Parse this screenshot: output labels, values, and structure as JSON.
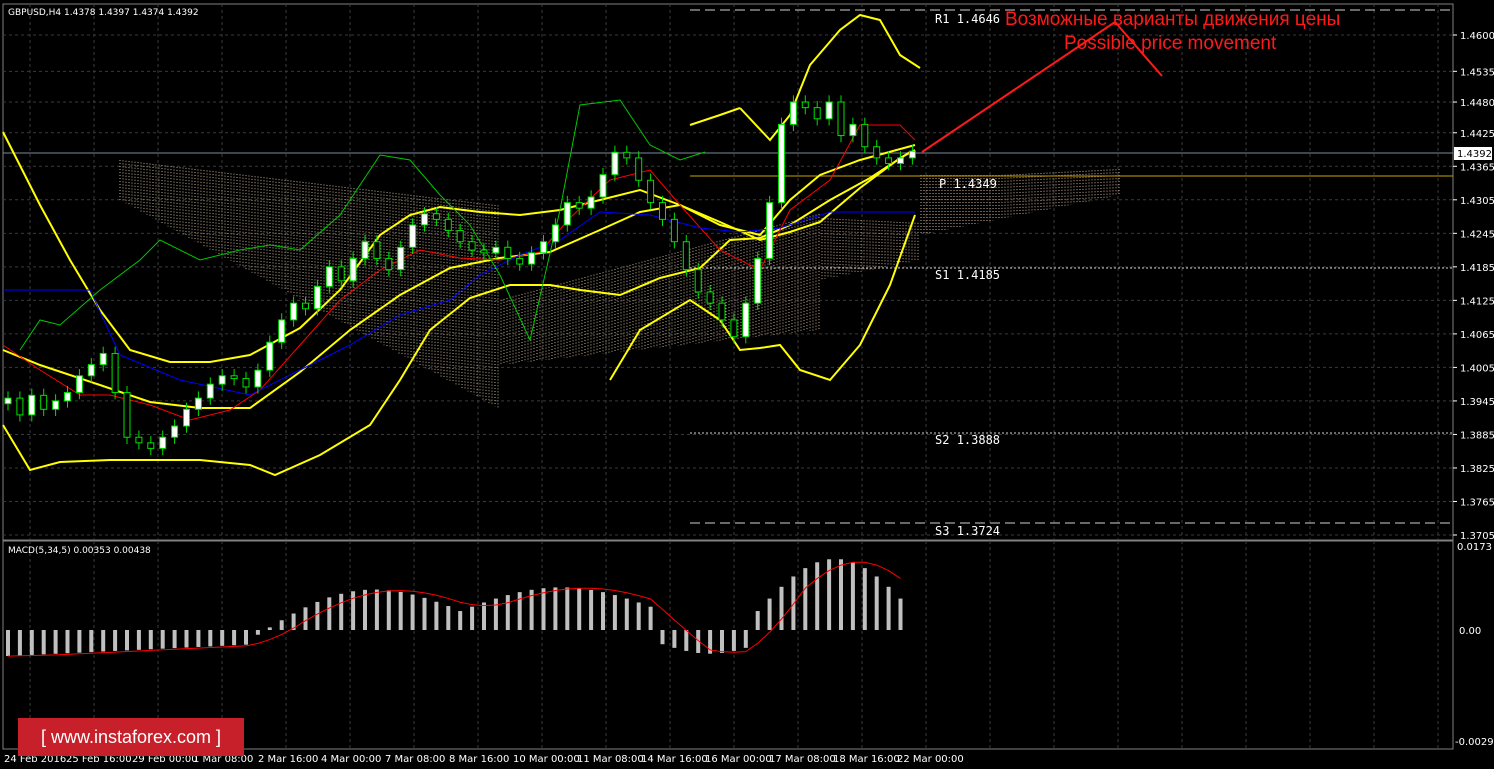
{
  "header": {
    "symbol_info": "GBPUSD,H4  1.4378 1.4397 1.4374 1.4392",
    "macd_info": "MACD(5,34,5) 0.00353 0.00438"
  },
  "annotation": {
    "line1": "Возможные варианты движения цены",
    "line2": "Possible price movement"
  },
  "pivots": [
    {
      "label": "R1",
      "value": "1.4646",
      "price": 1.4646
    },
    {
      "label": "P",
      "value": "1.4349",
      "price": 1.4349
    },
    {
      "label": "S1",
      "value": "1.4185",
      "price": 1.4185
    },
    {
      "label": "S2",
      "value": "1.3888",
      "price": 1.3888
    },
    {
      "label": "S3",
      "value": "1.3724",
      "price": 1.3724
    }
  ],
  "current_price": "1.4392",
  "watermark": "www.instaforex.com",
  "colors": {
    "bollinger": "#ffff00",
    "price_line": "#c0c0c0",
    "pivot_line": "#e0e0e0",
    "annotation": "#ff1a1a",
    "chikou": "#00c800",
    "kijun": "#0000ff",
    "tenkan": "#ff0000",
    "macd_bars": "#c0c0c0",
    "macd_signal": "#ff0000",
    "cloud_up": "#f5deb3",
    "cloud_down": "#ffdab9"
  },
  "chart_data": [
    {
      "type": "candlestick",
      "title": "GBPUSD,H4",
      "ylim": [
        1.3705,
        1.4646
      ],
      "y_ticks": [
        "1.4600",
        "1.4535",
        "1.4480",
        "1.4425",
        "1.4365",
        "1.4305",
        "1.4245",
        "1.4185",
        "1.4125",
        "1.4065",
        "1.4005",
        "1.3945",
        "1.3885",
        "1.3825",
        "1.3765",
        "1.3705"
      ],
      "x_ticks": [
        "24 Feb 2016",
        "25 Feb 16:00",
        "29 Feb 00:00",
        "1 Mar 08:00",
        "2 Mar 16:00",
        "4 Mar 00:00",
        "7 Mar 08:00",
        "8 Mar 16:00",
        "10 Mar 00:00",
        "11 Mar 08:00",
        "14 Mar 16:00",
        "16 Mar 00:00",
        "17 Mar 08:00",
        "18 Mar 16:00",
        "22 Mar 00:00"
      ],
      "close": [
        1.395,
        1.392,
        1.3955,
        1.393,
        1.3945,
        1.396,
        1.399,
        1.401,
        1.403,
        1.396,
        1.388,
        1.387,
        1.386,
        1.388,
        1.39,
        1.393,
        1.395,
        1.3975,
        1.399,
        1.3985,
        1.397,
        1.4,
        1.405,
        1.409,
        1.412,
        1.411,
        1.415,
        1.4185,
        1.416,
        1.42,
        1.423,
        1.42,
        1.418,
        1.422,
        1.426,
        1.428,
        1.427,
        1.425,
        1.423,
        1.4215,
        1.421,
        1.422,
        1.42,
        1.419,
        1.421,
        1.423,
        1.426,
        1.43,
        1.429,
        1.431,
        1.435,
        1.439,
        1.438,
        1.434,
        1.43,
        1.427,
        1.423,
        1.418,
        1.414,
        1.412,
        1.409,
        1.406,
        1.412,
        1.42,
        1.43,
        1.444,
        1.448,
        1.447,
        1.445,
        1.448,
        1.442,
        1.444,
        1.44,
        1.438,
        1.437,
        1.438,
        1.4392
      ],
      "series": [
        {
          "name": "MACD(5,34,5)",
          "ylim": [
            -0.00292,
            0.0173
          ]
        }
      ]
    }
  ]
}
